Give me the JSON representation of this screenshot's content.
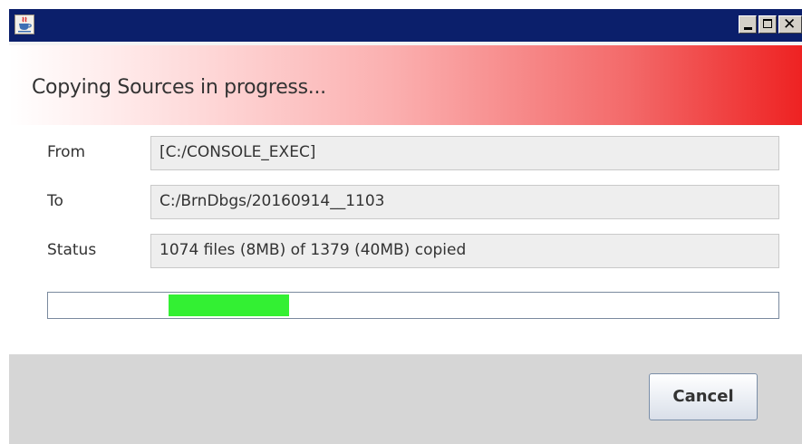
{
  "window": {
    "title": "",
    "buttons": {
      "minimize": "minimize",
      "maximize": "maximize",
      "close": "close"
    }
  },
  "header": {
    "title": "Copying Sources in progress..."
  },
  "fields": [
    {
      "label": "From",
      "value": "[C:/CONSOLE_EXEC]"
    },
    {
      "label": "To",
      "value": "C:/BrnDbgs/20160914__1103"
    },
    {
      "label": "Status",
      "value": "1074 files (8MB) of 1379 (40MB) copied"
    }
  ],
  "progress": {
    "indeterminate": true,
    "highlight_start_fraction": 0.165,
    "highlight_end_fraction": 0.33,
    "fill_color": "#33f033"
  },
  "footer": {
    "cancel_label": "Cancel"
  },
  "colors": {
    "titlebar": "#0b1f6b",
    "header_gradient_end": "#ee2222",
    "footer": "#d6d6d6"
  },
  "icons": {
    "app": "java-coffee-cup-icon"
  }
}
